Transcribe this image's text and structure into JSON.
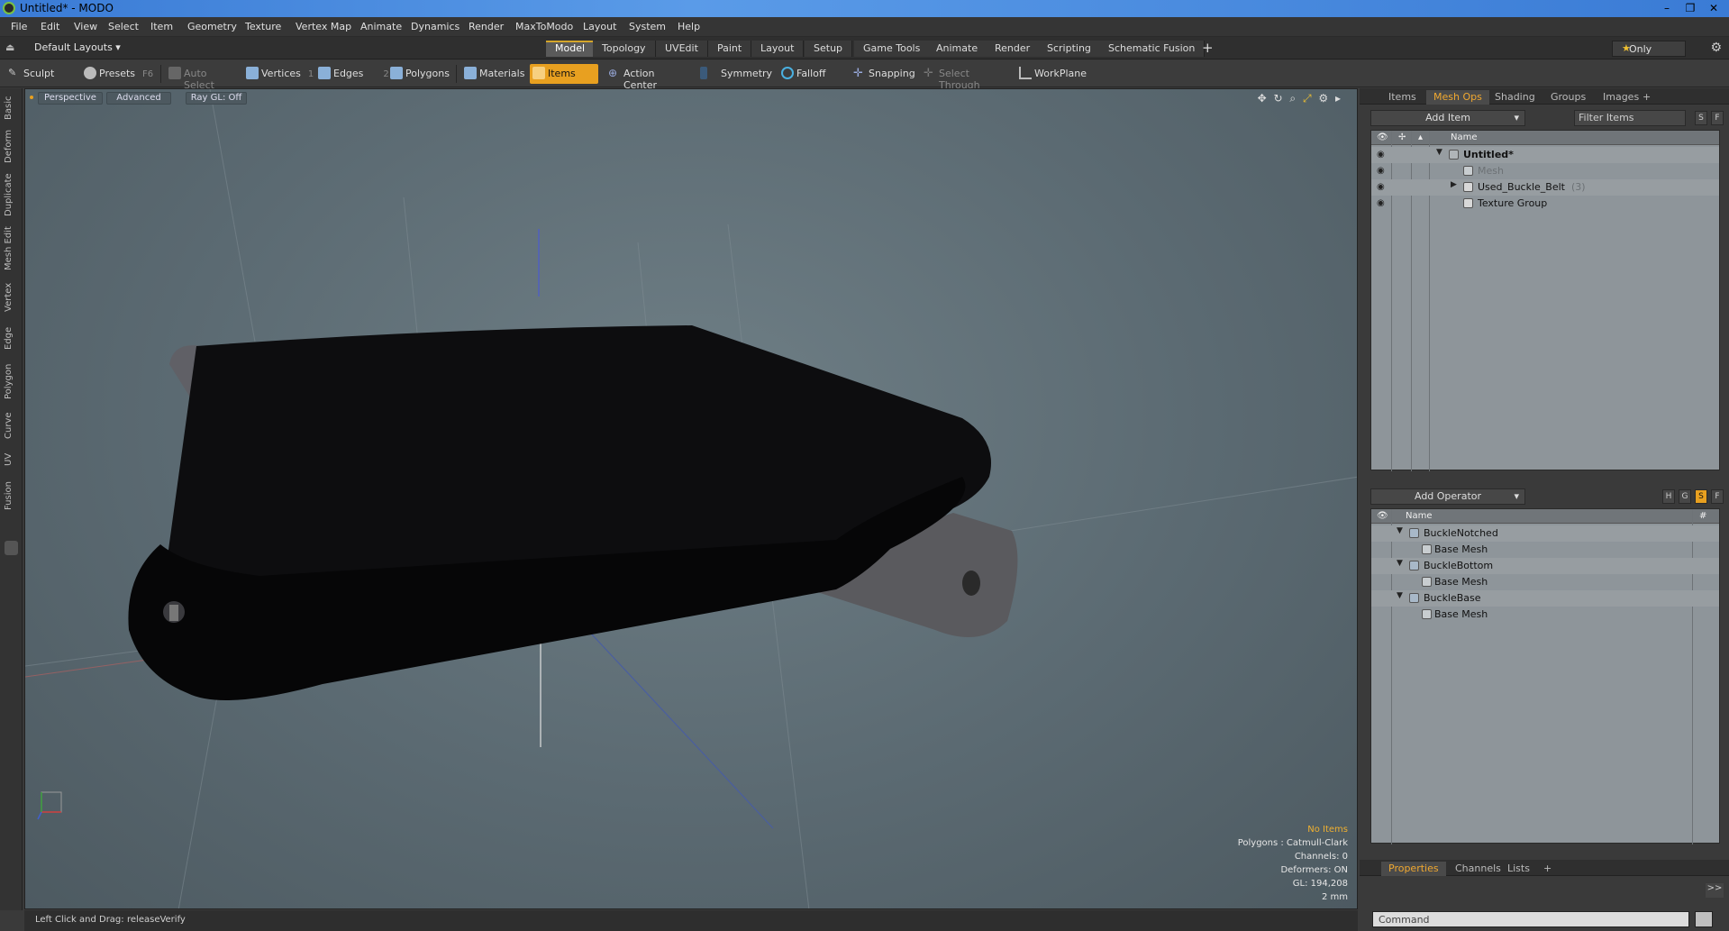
{
  "window": {
    "title": "Untitled* - MODO",
    "controls": [
      "–",
      "❐",
      "✕"
    ]
  },
  "menu": [
    "File",
    "Edit",
    "View",
    "Select",
    "Item",
    "Geometry",
    "Texture",
    "Vertex Map",
    "Animate",
    "Dynamics",
    "Render",
    "MaxToModo",
    "Layout",
    "System",
    "Help"
  ],
  "layout_bar": {
    "layouts_label": "Default Layouts ▾",
    "tabs": [
      "Model",
      "Topology",
      "UVEdit",
      "Paint",
      "Layout",
      "Setup",
      "Game Tools",
      "Animate",
      "Render",
      "Scripting",
      "Schematic Fusion"
    ],
    "active_tab": "Model",
    "add_tab": "+",
    "only_label": "Only"
  },
  "toolbar": {
    "sculpt": "Sculpt",
    "presets": "Presets",
    "presets_key": "F6",
    "auto_select": "Auto Select",
    "vertices": "Vertices",
    "vertices_key": "1",
    "edges": "Edges",
    "edges_key": "2",
    "polygons": "Polygons",
    "materials": "Materials",
    "items": "Items",
    "action_center": "Action Center",
    "symmetry": "Symmetry",
    "falloff": "Falloff",
    "snapping": "Snapping",
    "select_through": "Select Through",
    "workplane": "WorkPlane"
  },
  "left_tabs": [
    "Basic",
    "Deform",
    "Duplicate",
    "Mesh Edit",
    "Vertex",
    "Edge",
    "Polygon",
    "Curve",
    "UV",
    "Fusion"
  ],
  "viewport": {
    "view_mode": "Perspective",
    "advanced": "Advanced",
    "raygl": "Ray GL: Off",
    "info": {
      "no_items": "No Items",
      "polygons": "Polygons : Catmull-Clark",
      "channels": "Channels: 0",
      "deformers": "Deformers: ON",
      "gl": "GL: 194,208",
      "scale": "2 mm"
    }
  },
  "status": {
    "action": "Left Click and Drag:",
    "command": "releaseVerify"
  },
  "items_panel": {
    "tabs": [
      "Items",
      "Mesh Ops",
      "Shading",
      "Groups",
      "Images",
      "+"
    ],
    "active_tab": "Mesh Ops",
    "add_item": "Add Item",
    "filter_placeholder": "Filter Items",
    "s_btn": "S",
    "f_btn": "F",
    "name_header": "Name",
    "tree": [
      {
        "label": "Untitled*",
        "indent": 0
      },
      {
        "label": "Mesh",
        "indent": 1
      },
      {
        "label": "Used_Buckle_Belt",
        "count": "(3)",
        "indent": 1
      },
      {
        "label": "Texture Group",
        "indent": 1
      }
    ]
  },
  "meshops_panel": {
    "add_operator": "Add Operator",
    "h_btn": "H",
    "g_btn": "G",
    "s_btn": "S",
    "f_btn": "F",
    "name_header": "Name",
    "hash_header": "#",
    "rows": [
      {
        "label": "BuckleNotched",
        "type": "parent"
      },
      {
        "label": "Base Mesh",
        "type": "child"
      },
      {
        "label": "BuckleBottom",
        "type": "parent"
      },
      {
        "label": "Base Mesh",
        "type": "child"
      },
      {
        "label": "BuckleBase",
        "type": "parent"
      },
      {
        "label": "Base Mesh",
        "type": "child"
      }
    ]
  },
  "properties_panel": {
    "tabs": [
      "Properties",
      "Channels",
      "Lists",
      "+"
    ],
    "active_tab": "Properties",
    "expand": ">>",
    "command_placeholder": "Command"
  },
  "colors": {
    "accent": "#e8a020",
    "viewport_bg": "#5f6e76",
    "list_bg": "#8e959a"
  }
}
